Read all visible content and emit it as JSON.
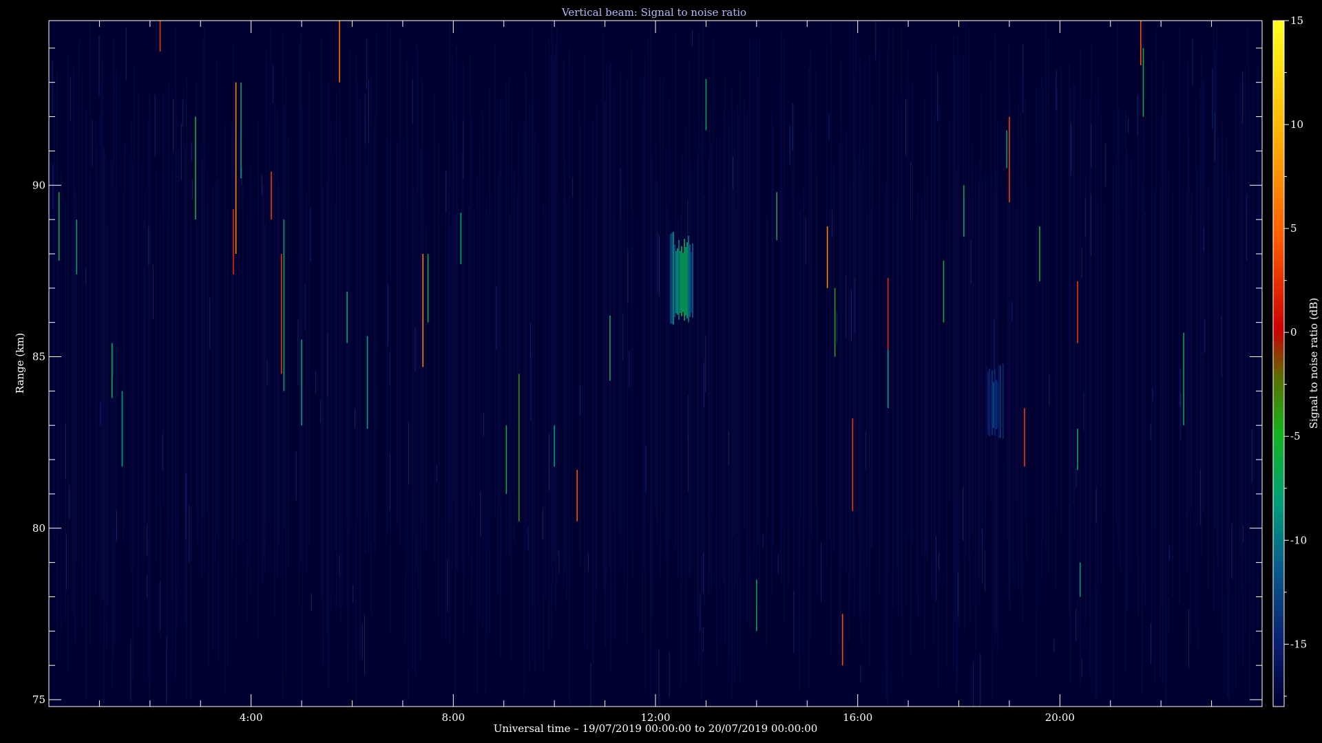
{
  "chart_data": {
    "type": "heatmap",
    "title": "Vertical beam: Signal to noise ratio",
    "xlabel": "Universal time – 19/07/2019 00:00:00 to 20/07/2019 00:00:00",
    "ylabel": "Range (km)",
    "x_ticks": [
      "4:00",
      "8:00",
      "12:00",
      "16:00",
      "20:00"
    ],
    "x_tick_hours": [
      4,
      8,
      12,
      16,
      20
    ],
    "xlim_hours": [
      0,
      24
    ],
    "y_ticks": [
      75,
      80,
      85,
      90
    ],
    "ylim": [
      74.8,
      94.8
    ],
    "colorbar": {
      "label": "Signal to noise ratio (dB)",
      "ticks": [
        15,
        10,
        5,
        0,
        -5,
        -10,
        -15
      ],
      "range": [
        -18,
        15
      ],
      "colors": [
        "#000030",
        "#0a1e6e",
        "#0a5a8c",
        "#00a078",
        "#14b41e",
        "#5a6e00",
        "#cc0000",
        "#ff5a00",
        "#ffaa00",
        "#ffff1e"
      ]
    },
    "background_color": "#000030",
    "features": [
      {
        "hour_start": 12.3,
        "hour_end": 12.75,
        "range_min": 85.9,
        "range_max": 88.7,
        "snr_db": -7
      },
      {
        "hour_start": 18.55,
        "hour_end": 18.9,
        "range_min": 82.6,
        "range_max": 84.8,
        "snr_db": -12
      }
    ],
    "streaks": [
      {
        "hour": 2.2,
        "range_min": 93.9,
        "range_max": 94.8,
        "snr_db": 3
      },
      {
        "hour": 3.65,
        "range_min": 87.4,
        "range_max": 89.3,
        "snr_db": 2
      },
      {
        "hour": 3.7,
        "range_min": 88.0,
        "range_max": 93.0,
        "snr_db": 7
      },
      {
        "hour": 4.4,
        "range_min": 89.0,
        "range_max": 90.4,
        "snr_db": 3
      },
      {
        "hour": 4.6,
        "range_min": 84.5,
        "range_max": 88.0,
        "snr_db": 3
      },
      {
        "hour": 5.75,
        "range_min": 93.0,
        "range_max": 94.8,
        "snr_db": 6
      },
      {
        "hour": 7.4,
        "range_min": 84.7,
        "range_max": 88.0,
        "snr_db": 6
      },
      {
        "hour": 9.3,
        "range_min": 80.2,
        "range_max": 84.5,
        "snr_db": -3
      },
      {
        "hour": 10.45,
        "range_min": 80.2,
        "range_max": 81.7,
        "snr_db": 4
      },
      {
        "hour": 15.4,
        "range_min": 87.0,
        "range_max": 88.8,
        "snr_db": 7
      },
      {
        "hour": 15.55,
        "range_min": 85.0,
        "range_max": 87.0,
        "snr_db": -4
      },
      {
        "hour": 15.7,
        "range_min": 76.0,
        "range_max": 77.5,
        "snr_db": 4
      },
      {
        "hour": 15.9,
        "range_min": 80.5,
        "range_max": 83.2,
        "snr_db": 3
      },
      {
        "hour": 16.6,
        "range_min": 85.0,
        "range_max": 87.3,
        "snr_db": 2
      },
      {
        "hour": 19.0,
        "range_min": 89.5,
        "range_max": 92.0,
        "snr_db": 3
      },
      {
        "hour": 19.3,
        "range_min": 81.8,
        "range_max": 83.5,
        "snr_db": 3
      },
      {
        "hour": 20.35,
        "range_min": 85.4,
        "range_max": 87.2,
        "snr_db": 3
      },
      {
        "hour": 21.6,
        "range_min": 93.5,
        "range_max": 94.8,
        "snr_db": 4
      },
      {
        "hour": 0.2,
        "range_min": 87.8,
        "range_max": 89.8,
        "snr_db": -6
      },
      {
        "hour": 0.55,
        "range_min": 87.4,
        "range_max": 89.0,
        "snr_db": -7
      },
      {
        "hour": 1.25,
        "range_min": 83.8,
        "range_max": 85.4,
        "snr_db": -6
      },
      {
        "hour": 1.45,
        "range_min": 81.8,
        "range_max": 84.0,
        "snr_db": -8
      },
      {
        "hour": 2.9,
        "range_min": 89.0,
        "range_max": 92.0,
        "snr_db": -6
      },
      {
        "hour": 3.8,
        "range_min": 90.2,
        "range_max": 93.0,
        "snr_db": -8
      },
      {
        "hour": 4.65,
        "range_min": 84.0,
        "range_max": 89.0,
        "snr_db": -7
      },
      {
        "hour": 5.0,
        "range_min": 83.0,
        "range_max": 85.5,
        "snr_db": -8
      },
      {
        "hour": 5.9,
        "range_min": 85.4,
        "range_max": 86.9,
        "snr_db": -7
      },
      {
        "hour": 6.3,
        "range_min": 82.9,
        "range_max": 85.6,
        "snr_db": -8
      },
      {
        "hour": 7.5,
        "range_min": 86.0,
        "range_max": 88.0,
        "snr_db": -6
      },
      {
        "hour": 8.15,
        "range_min": 87.7,
        "range_max": 89.2,
        "snr_db": -7
      },
      {
        "hour": 9.05,
        "range_min": 81.0,
        "range_max": 83.0,
        "snr_db": -6
      },
      {
        "hour": 10.0,
        "range_min": 81.8,
        "range_max": 83.0,
        "snr_db": -8
      },
      {
        "hour": 11.1,
        "range_min": 84.3,
        "range_max": 86.2,
        "snr_db": -7
      },
      {
        "hour": 13.0,
        "range_min": 91.6,
        "range_max": 93.1,
        "snr_db": -7
      },
      {
        "hour": 14.4,
        "range_min": 88.4,
        "range_max": 89.8,
        "snr_db": -7
      },
      {
        "hour": 16.6,
        "range_min": 83.5,
        "range_max": 85.2,
        "snr_db": -8
      },
      {
        "hour": 17.7,
        "range_min": 86.0,
        "range_max": 87.8,
        "snr_db": -6
      },
      {
        "hour": 18.1,
        "range_min": 88.5,
        "range_max": 90.0,
        "snr_db": -7
      },
      {
        "hour": 18.95,
        "range_min": 90.5,
        "range_max": 91.6,
        "snr_db": -8
      },
      {
        "hour": 19.6,
        "range_min": 87.2,
        "range_max": 88.8,
        "snr_db": -6
      },
      {
        "hour": 20.35,
        "range_min": 81.7,
        "range_max": 82.9,
        "snr_db": -7
      },
      {
        "hour": 20.4,
        "range_min": 78.0,
        "range_max": 79.0,
        "snr_db": -8
      },
      {
        "hour": 21.65,
        "range_min": 92.0,
        "range_max": 94.0,
        "snr_db": -6
      },
      {
        "hour": 22.45,
        "range_min": 83.0,
        "range_max": 85.7,
        "snr_db": -7
      },
      {
        "hour": 14.0,
        "range_min": 77.0,
        "range_max": 78.5,
        "snr_db": -7
      }
    ]
  }
}
